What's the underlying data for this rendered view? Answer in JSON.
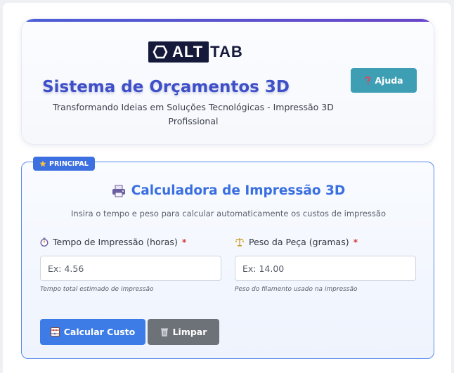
{
  "header": {
    "logo": {
      "left": "ALT",
      "right": "TAB",
      "icon": "hexagon-icon"
    },
    "title": "Sistema de Orçamentos 3D",
    "subtitle": "Transformando Ideias em Soluções Tecnológicas - Impressão 3D Profissional",
    "help_button": {
      "label": "Ajuda",
      "icon": "question-icon"
    }
  },
  "calculator": {
    "badge": {
      "label": "PRINCIPAL",
      "icon": "star-icon"
    },
    "title": "Calculadora de Impressão 3D",
    "title_icon": "printer-icon",
    "description": "Insira o tempo e peso para calcular automaticamente os custos de impressão",
    "fields": [
      {
        "label": "Tempo de Impressão (horas)",
        "required_mark": "*",
        "icon": "stopwatch-icon",
        "value": "",
        "placeholder": "Ex: 4.56",
        "hint": "Tempo total estimado de impressão"
      },
      {
        "label": "Peso da Peça (gramas)",
        "required_mark": "*",
        "icon": "scale-icon",
        "value": "",
        "placeholder": "Ex: 14.00",
        "hint": "Peso do filamento usado na impressão"
      }
    ],
    "buttons": {
      "calculate": {
        "label": "Calcular Custo",
        "icon": "abacus-icon"
      },
      "clear": {
        "label": "Limpar",
        "icon": "trash-icon"
      }
    }
  },
  "colors": {
    "title": "#3e4fc8",
    "accent": "#3d7ce6",
    "help": "#3e9fb4",
    "clear": "#6c7278",
    "required": "#d63a3a"
  }
}
